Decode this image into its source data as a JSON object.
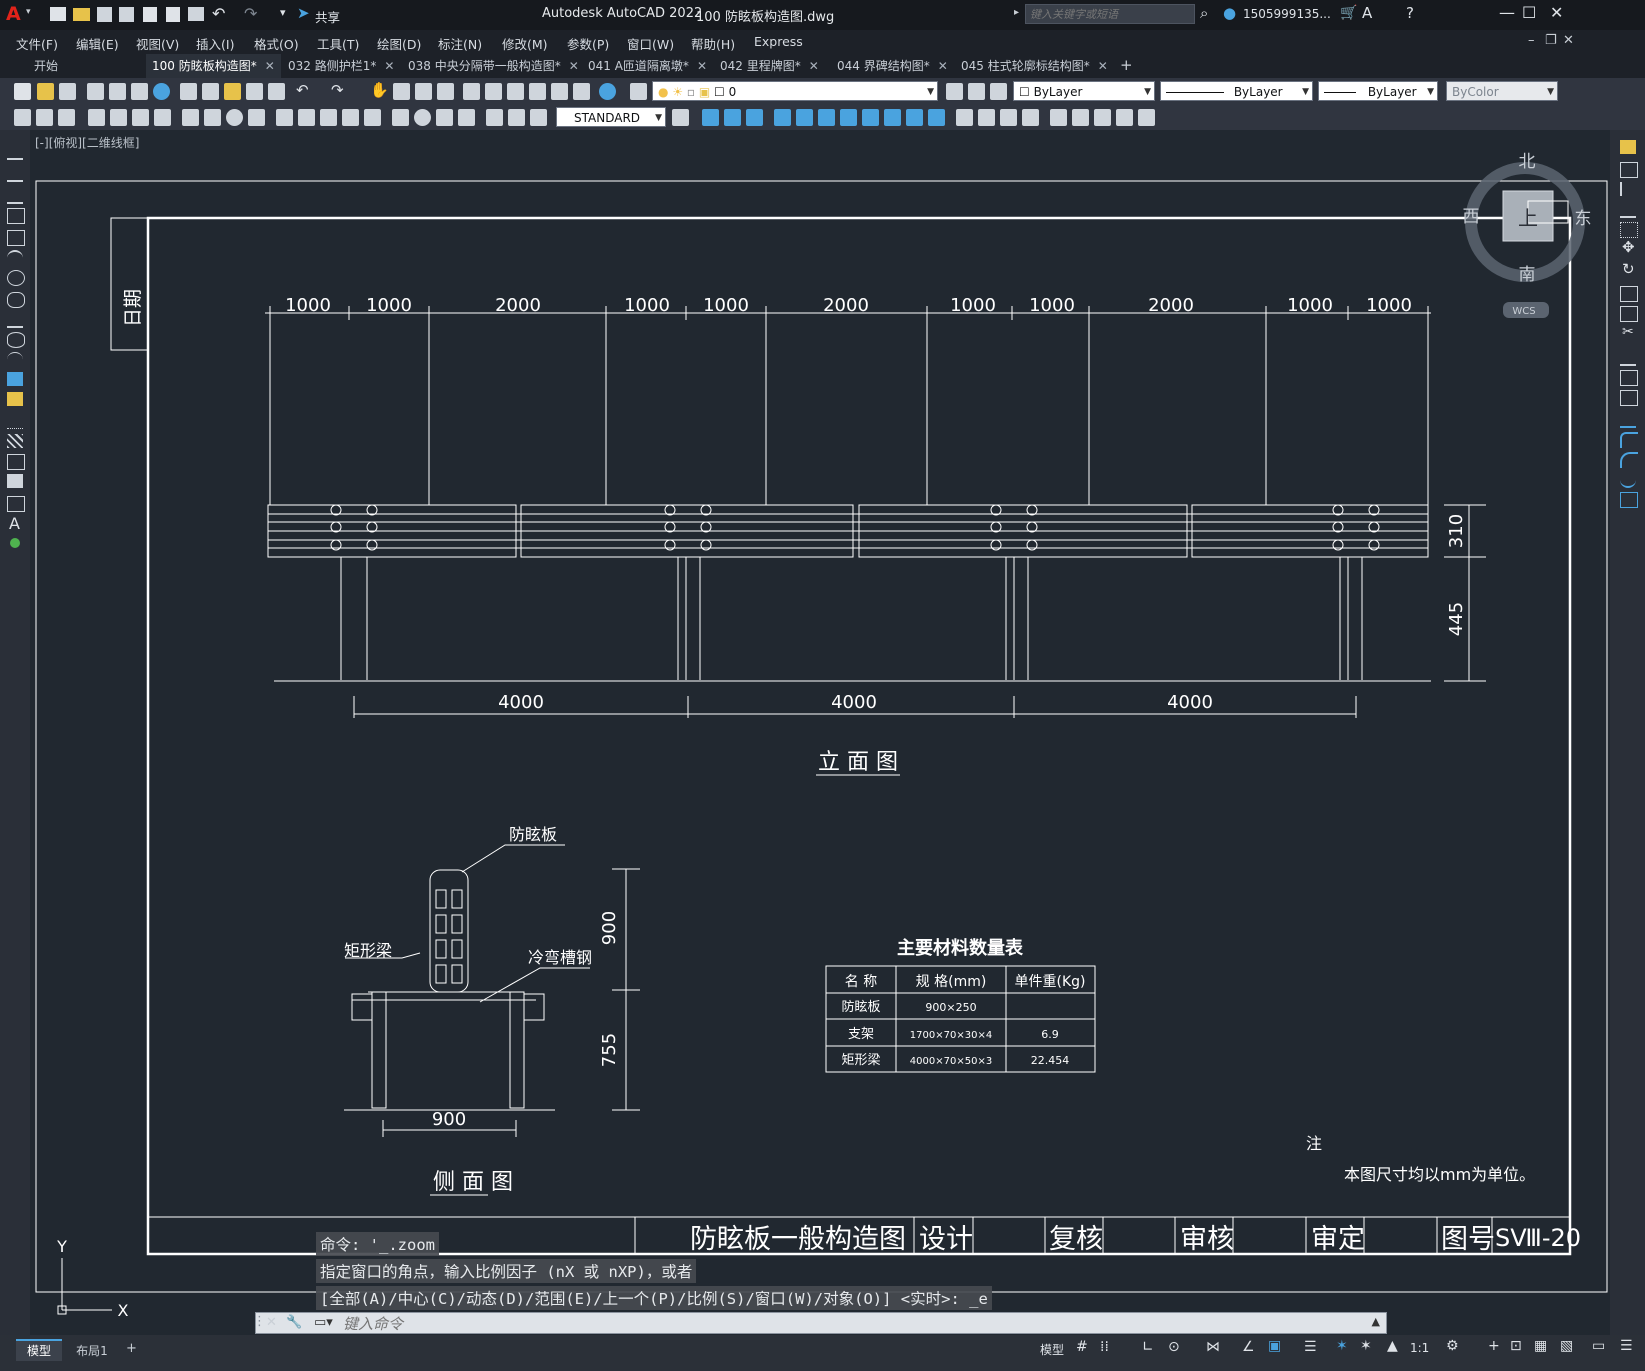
{
  "window": {
    "app_title": "Autodesk AutoCAD 2022",
    "file_title": "100 防眩板构造图.dwg",
    "share_label": "共享",
    "search_placeholder": "键入关键字或短语",
    "user": "1505999135...",
    "controls": [
      "—",
      "☐",
      "✕"
    ]
  },
  "menu": [
    "文件(F)",
    "编辑(E)",
    "视图(V)",
    "插入(I)",
    "格式(O)",
    "工具(T)",
    "绘图(D)",
    "标注(N)",
    "修改(M)",
    "参数(P)",
    "窗口(W)",
    "帮助(H)",
    "Express"
  ],
  "tabs": [
    {
      "label": "开始",
      "active": false,
      "closable": false
    },
    {
      "label": "100 防眩板构造图*",
      "active": true,
      "closable": true
    },
    {
      "label": "032 路侧护栏1*",
      "active": false,
      "closable": true
    },
    {
      "label": "038 中央分隔带一般构造图*",
      "active": false,
      "closable": true
    },
    {
      "label": "041 A匝道隔离墩*",
      "active": false,
      "closable": true
    },
    {
      "label": "042 里程牌图*",
      "active": false,
      "closable": true
    },
    {
      "label": "044 界碑结构图*",
      "active": false,
      "closable": true
    },
    {
      "label": "045 柱式轮廓标结构图*",
      "active": false,
      "closable": true
    }
  ],
  "properties": {
    "layer": "0",
    "color": "ByLayer",
    "linetype": "ByLayer",
    "lineweight": "ByLayer",
    "plotstyle": "ByColor",
    "textstyle": "STANDARD"
  },
  "viewport_label": "[-][俯视][二维线框]",
  "viewcube": {
    "north": "北",
    "south": "南",
    "east": "东",
    "west": "西",
    "top": "上",
    "wcs": "WCS"
  },
  "drawing": {
    "date_label": "日期",
    "elevation_dims_top": [
      "1000",
      "1000",
      "2000",
      "1000",
      "1000",
      "2000",
      "1000",
      "1000",
      "2000",
      "1000",
      "1000"
    ],
    "elevation_dims_bottom": [
      "4000",
      "4000",
      "4000"
    ],
    "elevation_dims_right": [
      "310",
      "445"
    ],
    "elevation_title": "立 面 图",
    "side_title": "侧 面 图",
    "side_labels": {
      "panel": "防眩板",
      "beam": "矩形梁",
      "channel": "冷弯槽钢"
    },
    "side_dims": {
      "height_top": "900",
      "height_bottom": "755",
      "width": "900"
    },
    "table": {
      "title": "主要材料数量表",
      "headers": [
        "名 称",
        "规 格(mm)",
        "单件重(Kg)"
      ],
      "rows": [
        [
          "防眩板",
          "900×250",
          ""
        ],
        [
          "支架",
          "1700×70×30×4",
          "6.9"
        ],
        [
          "矩形梁",
          "4000×70×50×3",
          "22.454"
        ]
      ]
    },
    "note_title": "注",
    "note_text": "本图尺寸均以mm为单位。",
    "title_block": {
      "name": "防眩板一般构造图",
      "design": "设计",
      "review": "复核",
      "audit": "审核",
      "approve": "审定",
      "drawing_no_label": "图号",
      "drawing_no": "SⅧ-20"
    },
    "ucs": {
      "y": "Y",
      "x": "X"
    }
  },
  "command": {
    "history": [
      "命令: '_.zoom",
      "指定窗口的角点，输入比例因子 (nX 或 nXP)，或者",
      "[全部(A)/中心(C)/动态(D)/范围(E)/上一个(P)/比例(S)/窗口(W)/对象(O)] <实时>: _e"
    ],
    "placeholder": "键入命令"
  },
  "status": {
    "layout_tabs": [
      "模型",
      "布局1"
    ],
    "model_label": "模型",
    "scale": "1:1"
  }
}
